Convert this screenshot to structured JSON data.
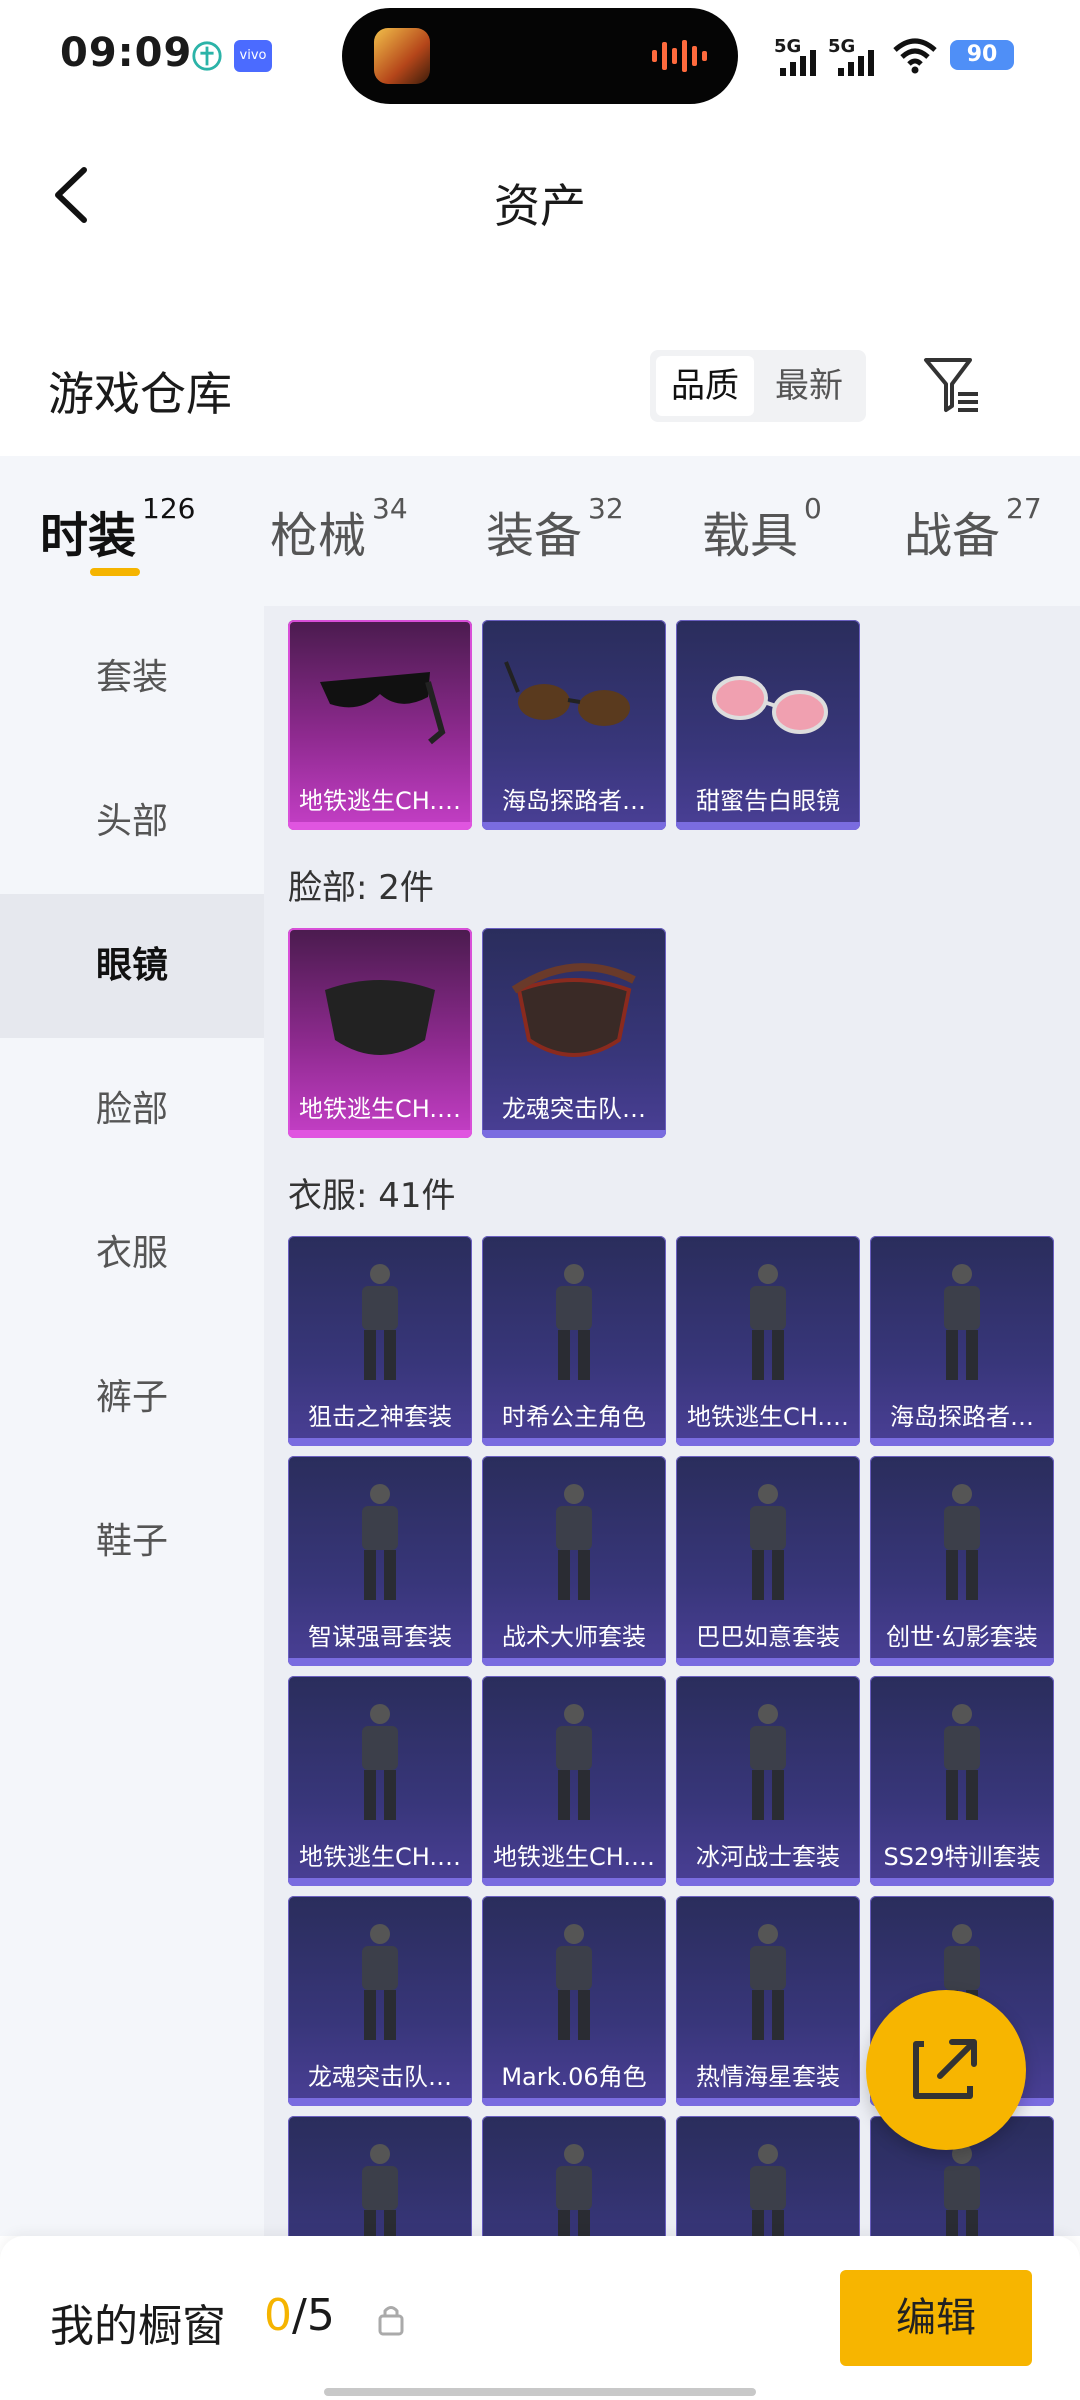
{
  "status_bar": {
    "time": "09:09",
    "network_1": "5G",
    "network_2": "5G",
    "battery": "90"
  },
  "header": {
    "title": "资产"
  },
  "warehouse": {
    "title": "游戏仓库",
    "sort_quality": "品质",
    "sort_newest": "最新"
  },
  "tabs": [
    {
      "label": "时装",
      "count": "126"
    },
    {
      "label": "枪械",
      "count": "34"
    },
    {
      "label": "装备",
      "count": "32"
    },
    {
      "label": "载具",
      "count": "0"
    },
    {
      "label": "战备",
      "count": "27"
    }
  ],
  "sidebar": {
    "items": [
      "套装",
      "头部",
      "眼镜",
      "脸部",
      "衣服",
      "裤子",
      "鞋子"
    ],
    "active": "眼镜"
  },
  "sections": {
    "glasses_items": [
      "地铁逃生CH.…",
      "海岛探路者…",
      "甜蜜告白眼镜"
    ],
    "face_title": "脸部: 2件",
    "face_items": [
      "地铁逃生CH.…",
      "龙魂突击队…"
    ],
    "clothes_title": "衣服: 41件",
    "clothes_items": [
      "狙击之神套装",
      "时希公主角色",
      "地铁逃生CH.…",
      "海岛探路者…",
      "智谋强哥套装",
      "战术大师套装",
      "巴巴如意套装",
      "创世·幻影套装",
      "地铁逃生CH.…",
      "地铁逃生CH.…",
      "冰河战士套装",
      "SS29特训套装",
      "龙魂突击队…",
      "Mark.06角色",
      "热情海星套装",
      ""
    ]
  },
  "bottom_bar": {
    "label": "我的橱窗",
    "count_current": "0",
    "count_total": "/5",
    "edit": "编辑"
  },
  "colors": {
    "accent": "#f7b500",
    "rarity_legendary": "#c53fc7",
    "rarity_epic": "#4a3f96"
  }
}
